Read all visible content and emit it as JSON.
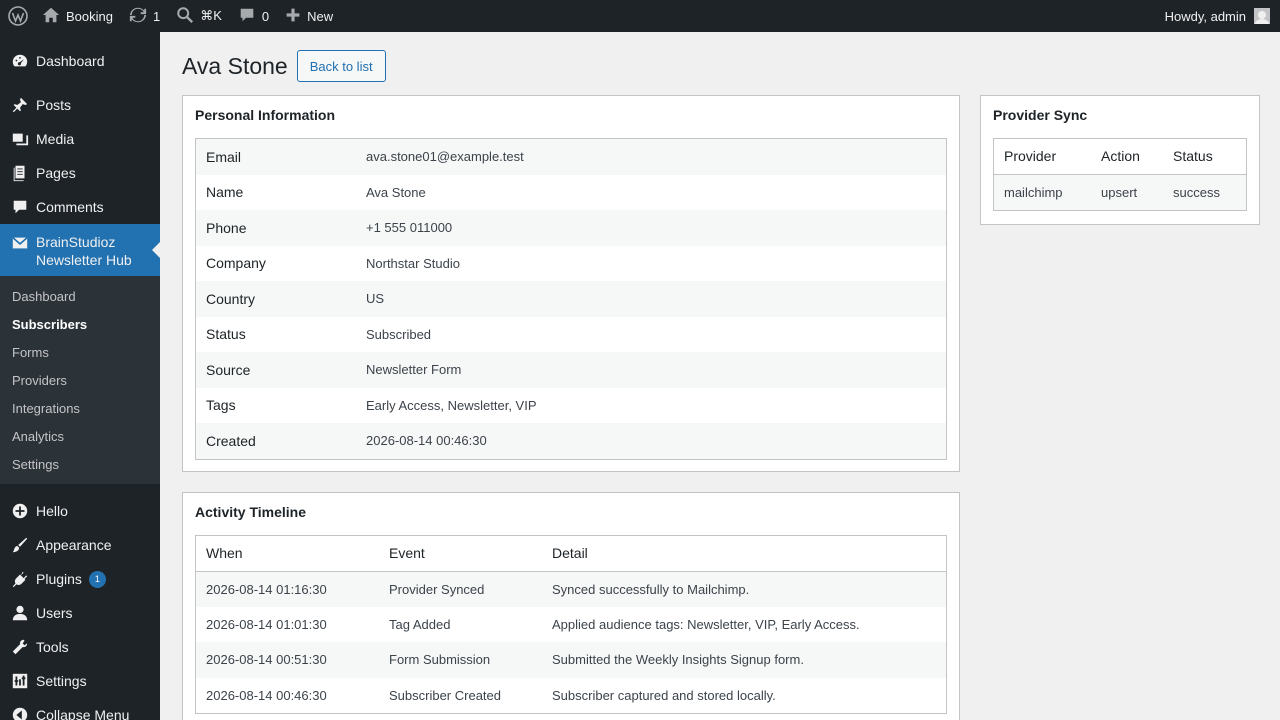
{
  "adminbar": {
    "site_name": "Booking",
    "updates_count": "1",
    "search_shortcut": "⌘K",
    "comments_count": "0",
    "new_label": "New",
    "greeting": "Howdy, admin"
  },
  "sidebar": {
    "items_top": [
      {
        "label": "Dashboard",
        "icon": "dashboard-icon"
      },
      {
        "label": "Posts",
        "icon": "pin-icon"
      },
      {
        "label": "Media",
        "icon": "media-icon"
      },
      {
        "label": "Pages",
        "icon": "pages-icon"
      },
      {
        "label": "Comments",
        "icon": "comment-icon"
      }
    ],
    "current": {
      "label_line1": "BrainStudioz",
      "label_line2": "Newsletter Hub",
      "icon": "envelope-icon"
    },
    "submenu": [
      "Dashboard",
      "Subscribers",
      "Forms",
      "Providers",
      "Integrations",
      "Analytics",
      "Settings"
    ],
    "submenu_current": "Subscribers",
    "items_bottom": [
      {
        "label": "Hello",
        "icon": "plus-circle-icon"
      },
      {
        "label": "Appearance",
        "icon": "brush-icon"
      },
      {
        "label": "Plugins",
        "icon": "plug-icon",
        "badge": "1"
      },
      {
        "label": "Users",
        "icon": "user-icon"
      },
      {
        "label": "Tools",
        "icon": "wrench-icon"
      },
      {
        "label": "Settings",
        "icon": "settings-icon"
      },
      {
        "label": "Collapse Menu",
        "icon": "collapse-icon"
      }
    ]
  },
  "page": {
    "title": "Ava Stone",
    "back_label": "Back to list"
  },
  "personal": {
    "title": "Personal Information",
    "rows": [
      {
        "key": "Email",
        "value": "ava.stone01@example.test"
      },
      {
        "key": "Name",
        "value": "Ava Stone"
      },
      {
        "key": "Phone",
        "value": "+1 555 011000"
      },
      {
        "key": "Company",
        "value": "Northstar Studio"
      },
      {
        "key": "Country",
        "value": "US"
      },
      {
        "key": "Status",
        "value": "Subscribed"
      },
      {
        "key": "Source",
        "value": "Newsletter Form"
      },
      {
        "key": "Tags",
        "value": "Early Access, Newsletter, VIP"
      },
      {
        "key": "Created",
        "value": "2026-08-14 00:46:30"
      }
    ]
  },
  "timeline": {
    "title": "Activity Timeline",
    "columns": [
      "When",
      "Event",
      "Detail"
    ],
    "rows": [
      {
        "when": "2026-08-14 01:16:30",
        "event": "Provider Synced",
        "detail": "Synced successfully to Mailchimp."
      },
      {
        "when": "2026-08-14 01:01:30",
        "event": "Tag Added",
        "detail": "Applied audience tags: Newsletter, VIP, Early Access."
      },
      {
        "when": "2026-08-14 00:51:30",
        "event": "Form Submission",
        "detail": "Submitted the Weekly Insights Signup form."
      },
      {
        "when": "2026-08-14 00:46:30",
        "event": "Subscriber Created",
        "detail": "Subscriber captured and stored locally."
      }
    ]
  },
  "sync": {
    "title": "Provider Sync",
    "columns": [
      "Provider",
      "Action",
      "Status"
    ],
    "rows": [
      {
        "provider": "mailchimp",
        "action": "upsert",
        "status": "success"
      }
    ]
  }
}
